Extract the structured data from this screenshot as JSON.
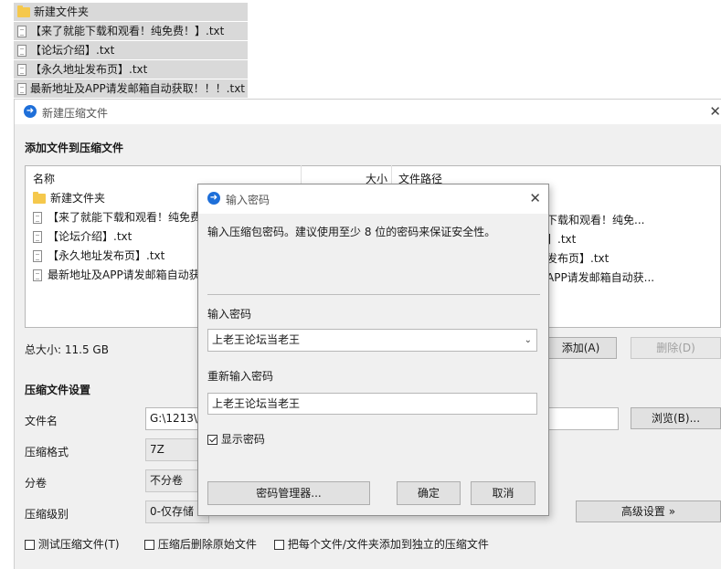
{
  "desktop": {
    "items": [
      {
        "icon": "folder-icon",
        "name": "新建文件夹"
      },
      {
        "icon": "text-file-icon",
        "name": "【来了就能下载和观看！纯免费！】.txt"
      },
      {
        "icon": "text-file-icon",
        "name": "【论坛介绍】.txt"
      },
      {
        "icon": "text-file-icon",
        "name": "【永久地址发布页】.txt"
      },
      {
        "icon": "text-file-icon",
        "name": "最新地址及APP请发邮箱自动获取！！！.txt"
      }
    ]
  },
  "main_window": {
    "title": "新建压缩文件",
    "close_glyph": "✕",
    "add_files_heading": "添加文件到压缩文件",
    "columns": {
      "name": "名称",
      "size": "大小",
      "path": "文件路径"
    },
    "files": [
      {
        "icon": "folder-icon",
        "name": "新建文件夹",
        "path": ""
      },
      {
        "icon": "text-file-icon",
        "name": "【来了就能下载和观看！纯免费",
        "path": "下载和观看！纯免..."
      },
      {
        "icon": "text-file-icon",
        "name": "【论坛介绍】.txt",
        "path": "】.txt"
      },
      {
        "icon": "text-file-icon",
        "name": "【永久地址发布页】.txt",
        "path": "发布页】.txt"
      },
      {
        "icon": "text-file-icon",
        "name": "最新地址及APP请发邮箱自动获",
        "path": "APP请发邮箱自动获..."
      }
    ],
    "total_size": "总大小: 11.5 GB",
    "add_button": "添加(A)",
    "delete_button": "删除(D)",
    "settings_heading": "压缩文件设置",
    "filename_label": "文件名",
    "filename_value": "G:\\1213\\",
    "browse_button": "浏览(B)...",
    "format_label": "压缩格式",
    "format_value": "7Z",
    "volume_label": "分卷",
    "volume_value": "不分卷",
    "level_label": "压缩级别",
    "level_value": "0-仅存储",
    "advanced_button": "高级设置 »",
    "options": [
      {
        "label": "测试压缩文件(T)",
        "checked": false
      },
      {
        "label": "压缩后删除原始文件",
        "checked": false
      },
      {
        "label": "把每个文件/文件夹添加到独立的压缩文件",
        "checked": false
      }
    ]
  },
  "password_dialog": {
    "title": "输入密码",
    "close_glyph": "✕",
    "hint": "输入压缩包密码。建议使用至少 8 位的密码来保证安全性。",
    "password_label": "输入密码",
    "password_value": "上老王论坛当老王",
    "confirm_label": "重新输入密码",
    "confirm_value": "上老王论坛当老王",
    "show_password_label": "显示密码",
    "show_password_checked": true,
    "manager_button": "密码管理器...",
    "ok_button": "确定",
    "cancel_button": "取消"
  }
}
